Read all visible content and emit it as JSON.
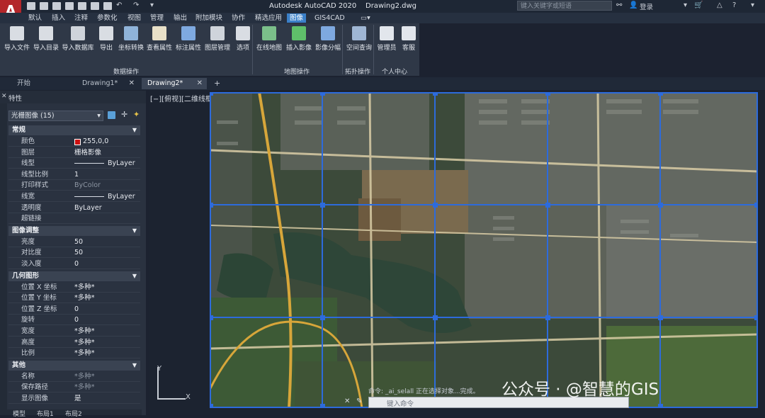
{
  "app": {
    "logo": "A",
    "title": "Autodesk AutoCAD 2020",
    "file": "Drawing2.dwg",
    "search_placeholder": "键入关键字或短语",
    "login": "登录"
  },
  "menu_tabs": [
    "默认",
    "插入",
    "注释",
    "参数化",
    "视图",
    "管理",
    "输出",
    "附加模块",
    "协作",
    "精选应用",
    "图像",
    "GIS4CAD"
  ],
  "active_menu_tab": "图像",
  "ribbon": {
    "groups": [
      {
        "label": "数据操作",
        "buttons": [
          "导入文件",
          "导入目录",
          "导入数据库",
          "导出",
          "坐标转换",
          "查看属性",
          "标注属性",
          "图层管理",
          "选项"
        ]
      },
      {
        "label": "地图操作",
        "buttons": [
          "在线地图",
          "插入影像",
          "影像分幅"
        ]
      },
      {
        "label": "拓扑操作",
        "buttons": [
          "空间查询"
        ]
      },
      {
        "label": "个人中心",
        "buttons": [
          "管理员",
          "客服"
        ]
      }
    ]
  },
  "doc_tabs": [
    {
      "label": "开始",
      "closable": false
    },
    {
      "label": "Drawing1*",
      "closable": true
    },
    {
      "label": "Drawing2*",
      "closable": true,
      "active": true
    }
  ],
  "properties": {
    "title": "特性",
    "selection": "光栅图像 (15)",
    "sections": [
      {
        "title": "常规",
        "rows": [
          {
            "name": "颜色",
            "value": "255,0,0",
            "swatch": "#cc1111"
          },
          {
            "name": "图层",
            "value": "栅格影像"
          },
          {
            "name": "线型",
            "value": "ByLayer",
            "line": true
          },
          {
            "name": "线型比例",
            "value": "1"
          },
          {
            "name": "打印样式",
            "value": "ByColor",
            "dim": true
          },
          {
            "name": "线宽",
            "value": "ByLayer",
            "line": true
          },
          {
            "name": "透明度",
            "value": "ByLayer"
          },
          {
            "name": "超链接",
            "value": ""
          }
        ]
      },
      {
        "title": "图像调整",
        "rows": [
          {
            "name": "亮度",
            "value": "50"
          },
          {
            "name": "对比度",
            "value": "50"
          },
          {
            "name": "淡入度",
            "value": "0"
          }
        ]
      },
      {
        "title": "几何图形",
        "rows": [
          {
            "name": "位置 X 坐标",
            "value": "*多种*"
          },
          {
            "name": "位置 Y 坐标",
            "value": "*多种*"
          },
          {
            "name": "位置 Z 坐标",
            "value": "0"
          },
          {
            "name": "旋转",
            "value": "0"
          },
          {
            "name": "宽度",
            "value": "*多种*"
          },
          {
            "name": "高度",
            "value": "*多种*"
          },
          {
            "name": "比例",
            "value": "*多种*"
          }
        ]
      },
      {
        "title": "其他",
        "rows": [
          {
            "name": "名称",
            "value": "*多种*",
            "dim": true
          },
          {
            "name": "保存路径",
            "value": "*多种*",
            "dim": true
          },
          {
            "name": "显示图像",
            "value": "是"
          }
        ]
      }
    ]
  },
  "viewport": {
    "label": "[−][俯视][二维线框]",
    "ucs_x": "X",
    "ucs_y": "Y"
  },
  "command": {
    "history": "命令: _ai_selall 正在选择对象...完成。",
    "placeholder": "键入命令"
  },
  "layout_tabs": [
    "模型",
    "布局1",
    "布局2"
  ],
  "watermark": "公众号 · @智慧的GIS",
  "colors": {
    "accent": "#3b80c8",
    "grid_line": "#2d6bdc",
    "swatch_red": "#cc1111"
  }
}
